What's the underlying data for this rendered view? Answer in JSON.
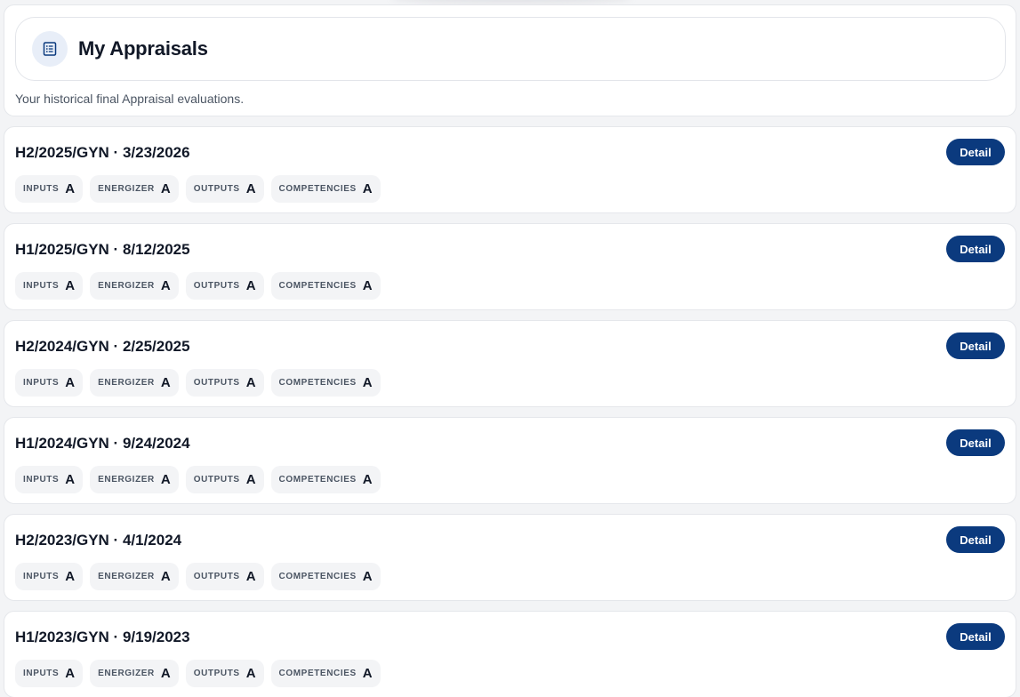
{
  "header": {
    "title": "My Appraisals",
    "subtitle": "Your historical final Appraisal evaluations.",
    "icon": "document-list-icon"
  },
  "colors": {
    "accent": "#0b3a7e",
    "icon_bg": "#e8eef8",
    "chip_bg": "#f3f4f6"
  },
  "appraisals": [
    {
      "title": "H2/2025/GYN · 3/23/2026",
      "detail_label": "Detail",
      "scores": [
        {
          "label": "INPUTS",
          "grade": "A"
        },
        {
          "label": "ENERGIZER",
          "grade": "A"
        },
        {
          "label": "OUTPUTS",
          "grade": "A"
        },
        {
          "label": "COMPETENCIES",
          "grade": "A"
        }
      ]
    },
    {
      "title": "H1/2025/GYN · 8/12/2025",
      "detail_label": "Detail",
      "scores": [
        {
          "label": "INPUTS",
          "grade": "A"
        },
        {
          "label": "ENERGIZER",
          "grade": "A"
        },
        {
          "label": "OUTPUTS",
          "grade": "A"
        },
        {
          "label": "COMPETENCIES",
          "grade": "A"
        }
      ]
    },
    {
      "title": "H2/2024/GYN · 2/25/2025",
      "detail_label": "Detail",
      "scores": [
        {
          "label": "INPUTS",
          "grade": "A"
        },
        {
          "label": "ENERGIZER",
          "grade": "A"
        },
        {
          "label": "OUTPUTS",
          "grade": "A"
        },
        {
          "label": "COMPETENCIES",
          "grade": "A"
        }
      ]
    },
    {
      "title": "H1/2024/GYN · 9/24/2024",
      "detail_label": "Detail",
      "scores": [
        {
          "label": "INPUTS",
          "grade": "A"
        },
        {
          "label": "ENERGIZER",
          "grade": "A"
        },
        {
          "label": "OUTPUTS",
          "grade": "A"
        },
        {
          "label": "COMPETENCIES",
          "grade": "A"
        }
      ]
    },
    {
      "title": "H2/2023/GYN · 4/1/2024",
      "detail_label": "Detail",
      "scores": [
        {
          "label": "INPUTS",
          "grade": "A"
        },
        {
          "label": "ENERGIZER",
          "grade": "A"
        },
        {
          "label": "OUTPUTS",
          "grade": "A"
        },
        {
          "label": "COMPETENCIES",
          "grade": "A"
        }
      ]
    },
    {
      "title": "H1/2023/GYN · 9/19/2023",
      "detail_label": "Detail",
      "scores": [
        {
          "label": "INPUTS",
          "grade": "A"
        },
        {
          "label": "ENERGIZER",
          "grade": "A"
        },
        {
          "label": "OUTPUTS",
          "grade": "A"
        },
        {
          "label": "COMPETENCIES",
          "grade": "A"
        }
      ]
    }
  ]
}
